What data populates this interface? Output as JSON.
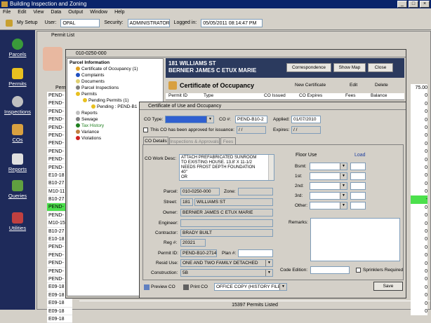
{
  "app": {
    "title": "Building Inspection and Zoning"
  },
  "menu": [
    "File",
    "Edit",
    "View",
    "Data",
    "Output",
    "Window",
    "Help"
  ],
  "toolbar": {
    "my_setup": "My Setup",
    "user_label": "User:",
    "user_value": "OPAL",
    "security_label": "Security:",
    "security_value": "ADMINISTRATOR",
    "logged_label": "Logged in:",
    "logged_value": "05/05/2011 08:14:47 PM"
  },
  "sidebar": [
    "Parcels",
    "Permits",
    "Inspections",
    "COs",
    "Reports",
    "Queries",
    "Utilities"
  ],
  "permit_list": {
    "title": "Permit List",
    "col_header": "Perm",
    "rows": [
      "PEND-",
      "PEND-",
      "PEND-",
      "PEND-",
      "PEND-",
      "PEND-",
      "PEND-",
      "PEND-",
      "PEND-",
      "PEND-",
      "E10-18",
      "B10-27",
      "M10-11",
      "B10-27",
      "PEND-",
      "PEND-",
      "M10-15",
      "B10-27",
      "E10-18",
      "PEND-",
      "PEND-",
      "PEND-",
      "PEND-",
      "PEND-",
      "E09-18",
      "E09-18",
      "E09-18",
      "E09-18",
      "E09-18"
    ],
    "right_values": [
      "75.00",
      "0",
      "0",
      "0",
      "0",
      "0",
      "0",
      "0",
      "0",
      "0",
      "0",
      "0",
      "0",
      "0",
      "-",
      "0",
      "0",
      "0",
      "0",
      "0",
      "0",
      "0",
      "0",
      "0",
      "0",
      "0",
      "0",
      "0",
      "0"
    ],
    "status": "15397 Permits Listed"
  },
  "parcel": {
    "title": "010-0250-000",
    "tree": [
      "Parcel Information",
      "Certificate of Occupancy (1)",
      "Complaints",
      "Documents",
      "Parcel Inspections",
      "Permits",
      "Pending Permits (1)",
      "Pending : PEND-B1",
      "Reports",
      "Sewage",
      "Tax History",
      "Variance",
      "Violations"
    ],
    "address": "181 WILLIAMS ST",
    "owner": "BERNIER JAMES C ETUX MARIE",
    "btn_correspondence": "Correspondence",
    "btn_show_map": "Show Map",
    "btn_close": "Close",
    "co_heading": "Certificate of Occupancy",
    "btn_new_cert": "New Certificate",
    "btn_edit": "Edit",
    "btn_delete": "Delete",
    "columns": [
      "Permit ID",
      "Type",
      "CO Issued",
      "CO Expires",
      "Fees",
      "Balance"
    ]
  },
  "dialog": {
    "title": "Certificate of Use and Occupancy",
    "co_type_label": "CO Type:",
    "co_num_label": "CO #:",
    "co_num": "PEND-B10-2",
    "applied_label": "Applied:",
    "applied": "01/07/2010",
    "approved_label": "This CO has been approved for issuance:",
    "approved_date": "/ /",
    "expires_label": "Expires:",
    "expires": "/ /",
    "tabs": [
      "CO Details",
      "Inspections & Approvals",
      "Fees"
    ],
    "work_desc_label": "CO Work Desc:",
    "work_desc": [
      "ATTACH PREFABRICATED SUNROOM",
      "TO EXISTING HOUSE. 13.8' X 11-1/2",
      "NEEDS FROST DEPTH FOUNDATION",
      "40\"",
      "OR"
    ],
    "parcel_label": "Parcel:",
    "parcel": "010-0250-000",
    "zone_label": "Zone:",
    "street_label": "Street:",
    "street_no": "181",
    "street": "WILLIAMS ST",
    "owner_label": "Owner:",
    "owner": "BERNIER JAMES C ETUX MARIE",
    "engineer_label": "Engineer:",
    "contractor_label": "Contractor:",
    "contractor": "BRADY BUILT",
    "reg_label": "Reg #:",
    "reg": "20321",
    "permit_label": "Permit ID:",
    "permit": "PEND-B10-2714",
    "plan_label": "Plan #:",
    "resid_label": "Resid Use:",
    "resid": "ONE AND TWO FAMILY DETACHED",
    "construction_label": "Construction:",
    "construction": "5B",
    "floor_use": "Floor Use",
    "load": "Load",
    "floors": [
      "Bsmt:",
      "1st:",
      "2nd:",
      "3rd:",
      "Other:"
    ],
    "remarks_label": "Remarks:",
    "code_label": "Code Edition:",
    "sprinklers": "Sprinklers Required",
    "preview": "Preview CO",
    "print": "Print CO",
    "print_option": "OFFICE COPY (HISTORY FILE)",
    "save": "Save"
  }
}
